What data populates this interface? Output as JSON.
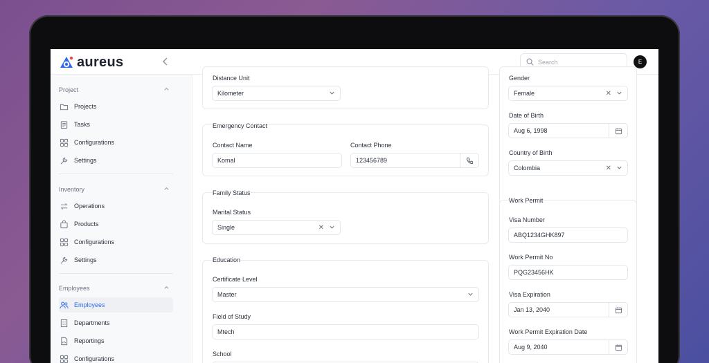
{
  "app": {
    "brand": "aureus",
    "avatar_letter": "E"
  },
  "search": {
    "placeholder": "Search"
  },
  "sidebar": {
    "groups": [
      {
        "title": "Project",
        "items": [
          {
            "label": "Projects",
            "icon": "folder-icon"
          },
          {
            "label": "Tasks",
            "icon": "clipboard-icon"
          },
          {
            "label": "Configurations",
            "icon": "grid-icon"
          },
          {
            "label": "Settings",
            "icon": "wrench-icon"
          }
        ]
      },
      {
        "title": "Inventory",
        "items": [
          {
            "label": "Operations",
            "icon": "arrows-icon"
          },
          {
            "label": "Products",
            "icon": "bag-icon"
          },
          {
            "label": "Configurations",
            "icon": "grid-icon"
          },
          {
            "label": "Settings",
            "icon": "wrench-icon"
          }
        ]
      },
      {
        "title": "Employees",
        "items": [
          {
            "label": "Employees",
            "icon": "users-icon",
            "active": true
          },
          {
            "label": "Departments",
            "icon": "building-icon"
          },
          {
            "label": "Reportings",
            "icon": "report-icon"
          },
          {
            "label": "Configurations",
            "icon": "grid-icon"
          }
        ]
      }
    ]
  },
  "form": {
    "distance_unit": {
      "label": "Distance Unit",
      "value": "Kilometer"
    },
    "emergency": {
      "title": "Emergency Contact",
      "name_label": "Contact Name",
      "name_value": "Komal",
      "phone_label": "Contact Phone",
      "phone_value": "123456789"
    },
    "family": {
      "title": "Family Status",
      "marital_label": "Marital Status",
      "marital_value": "Single"
    },
    "education": {
      "title": "Education",
      "cert_label": "Certificate Level",
      "cert_value": "Master",
      "field_label": "Field of Study",
      "field_value": "Mtech",
      "school_label": "School"
    },
    "personal": {
      "gender_label": "Gender",
      "gender_value": "Female",
      "dob_label": "Date of Birth",
      "dob_value": "Aug 6, 1998",
      "country_label": "Country of Birth",
      "country_value": "Colombia"
    },
    "work_permit": {
      "title": "Work Permit",
      "visa_label": "Visa Number",
      "visa_value": "ABQ1234GHK897",
      "permit_no_label": "Work Permit No",
      "permit_no_value": "PQG23456HK",
      "visa_exp_label": "Visa Expiration",
      "visa_exp_value": "Jan 13, 2040",
      "permit_exp_label": "Work Permit Expiration Date",
      "permit_exp_value": "Aug 9, 2040"
    }
  },
  "colors": {
    "accent": "#2f6bf0",
    "text": "#2c323d",
    "muted": "#6b7280",
    "border": "#e3e6ea"
  }
}
